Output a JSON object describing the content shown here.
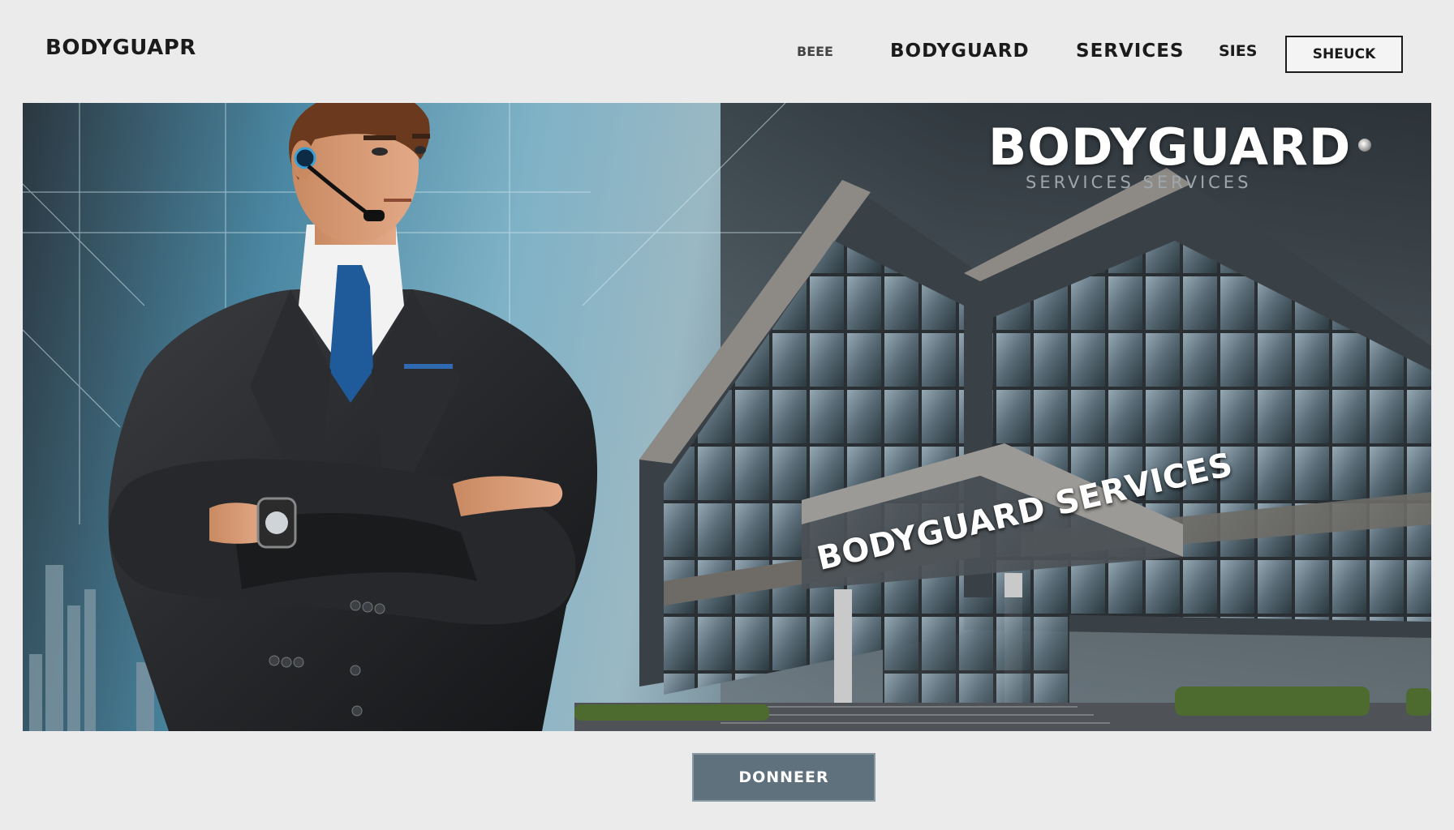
{
  "header": {
    "logo": "BODYGUAPR",
    "nav": [
      "BEEE",
      "BODYGUARD",
      "SERVICES",
      "SIES"
    ],
    "search_label": "SHEUCK"
  },
  "hero": {
    "title": "BODYGUARD",
    "subtitle": "SERVICES SERVICES",
    "facade_sign": "BODYGUARD SERVICES"
  },
  "cta": {
    "label": "DONNEER"
  },
  "colors": {
    "page_bg": "#ebebeb",
    "suit": "#1f2022",
    "tie": "#1f5a9a",
    "button_bg": "#5f717d",
    "sky_accent": "#4a87a2"
  }
}
